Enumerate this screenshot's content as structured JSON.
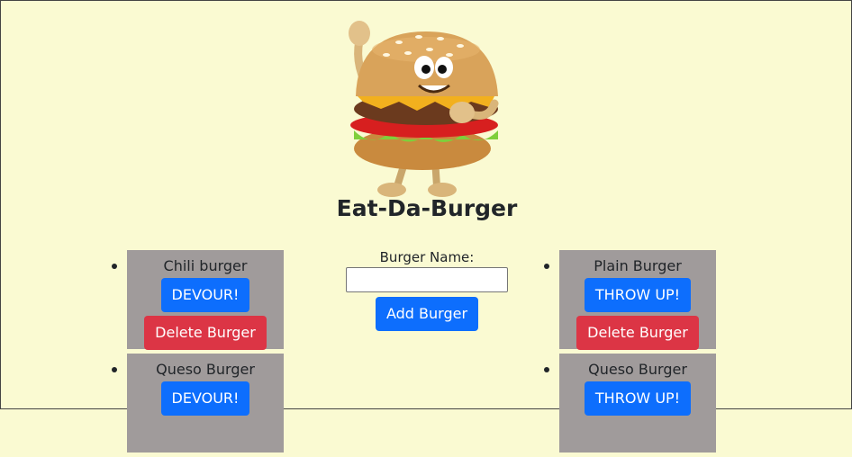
{
  "header": {
    "title": "Eat-Da-Burger",
    "mascot_icon": "burger-mascot-icon"
  },
  "form": {
    "label": "Burger Name:",
    "input_value": "",
    "input_placeholder": "",
    "submit_label": "Add Burger"
  },
  "left_list": [
    {
      "name": "Chili burger",
      "action_label": "DEVOUR!",
      "delete_label": "Delete Burger"
    },
    {
      "name": "Queso Burger",
      "action_label": "DEVOUR!"
    }
  ],
  "right_list": [
    {
      "name": "Plain Burger",
      "action_label": "THROW UP!",
      "delete_label": "Delete Burger"
    },
    {
      "name": "Queso Burger",
      "action_label": "THROW UP!"
    }
  ],
  "colors": {
    "background": "#fafad2",
    "card": "#a09b9b",
    "primary_button": "#0d6efd",
    "danger_button": "#dc3545"
  }
}
